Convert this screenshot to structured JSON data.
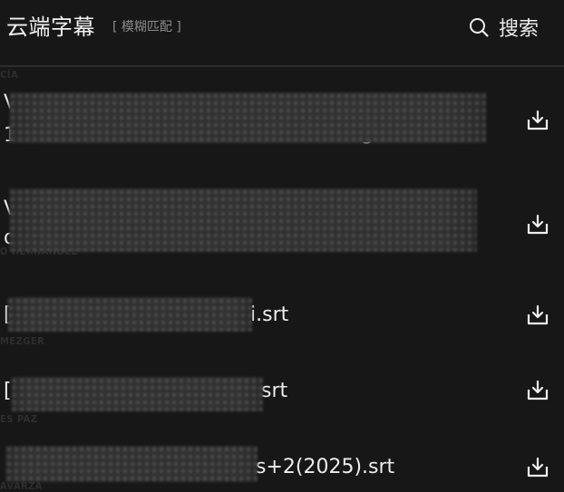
{
  "header": {
    "title": "云端字幕",
    "mode": "[ 模糊匹配 ]",
    "search_label": "搜索"
  },
  "background_fragments": [
    "CÍA",
    "MEZGER",
    "ES PAZ",
    "AVARZA",
    "O HERNÁNDEZ"
  ],
  "files": [
    {
      "name_lines": [
        "V",
        "1"
      ],
      "name_tail": "g"
    },
    {
      "name_lines": [
        "V",
        "d"
      ],
      "name_tail": ""
    },
    {
      "name_lines": [
        "["
      ],
      "name_tail": "i.srt"
    },
    {
      "name_lines": [
        "["
      ],
      "name_tail": "srt"
    },
    {
      "name_lines": [
        ""
      ],
      "name_tail": "s+2(2025).srt"
    }
  ],
  "icons": {
    "search": "search-icon",
    "download": "download-icon"
  }
}
